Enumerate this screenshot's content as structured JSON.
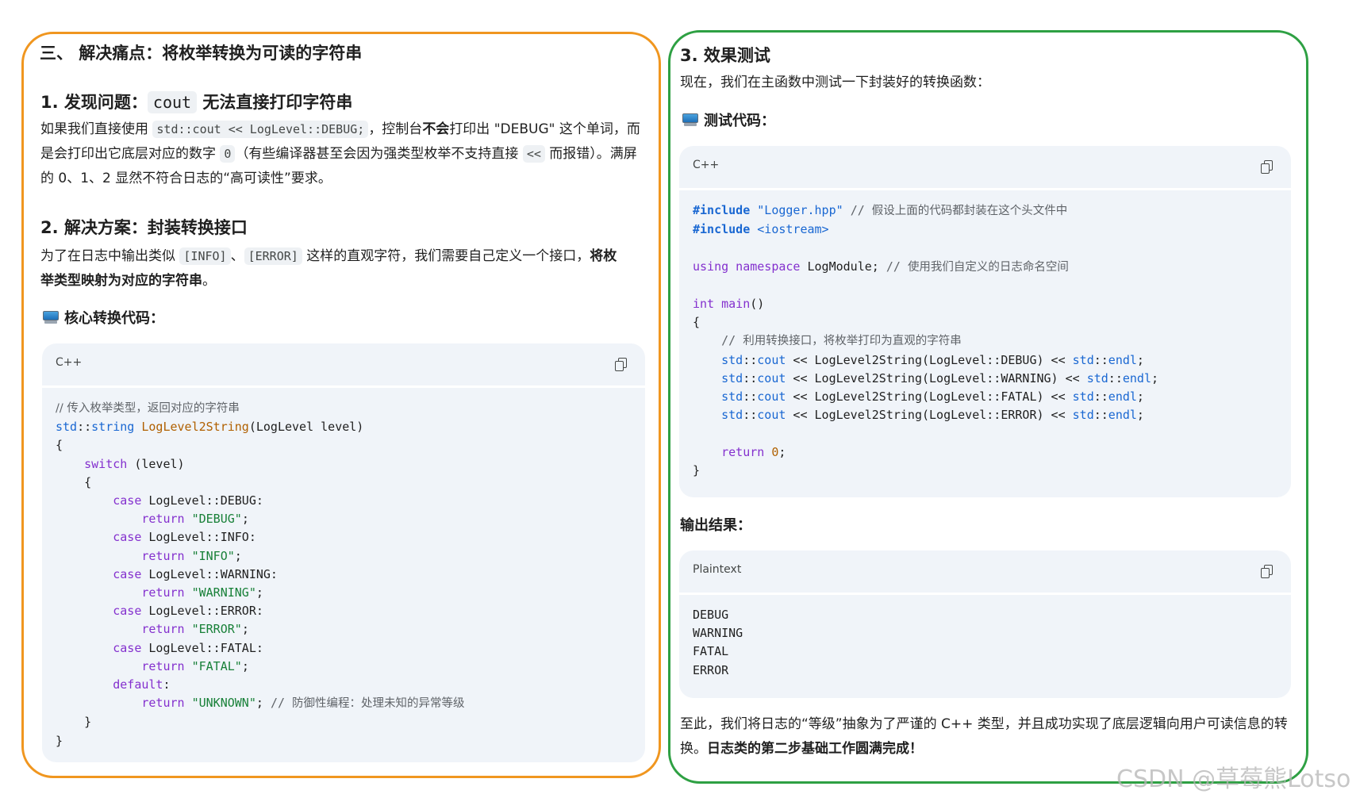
{
  "left": {
    "section_title": "三、 解决痛点：将枚举转换为可读的字符串",
    "step1": {
      "prefix": "1. 发现问题：",
      "code": "cout",
      "suffix": " 无法直接打印字符串"
    },
    "para1": {
      "t1": "如果我们直接使用 ",
      "c1": "std::cout << LogLevel::DEBUG;",
      "t2": "，控制台",
      "b1": "不会",
      "t3": "打印出 \"DEBUG\" 这个单词，而是会打印出它底层对应的数字 ",
      "c2": "0",
      "t4": "（有些编译器甚至会因为强类型枚举不支持直接 ",
      "c3": "<<",
      "t5": " 而报错）。满屏的 0、1、2 显然不符合日志的“高可读性”要求。"
    },
    "step2": "2. 解决方案：封装转换接口",
    "para2": {
      "t1": "为了在日志中输出类似 ",
      "c1": "[INFO]",
      "t2": "、",
      "c2": "[ERROR]",
      "t3": " 这样的直观字符，我们需要自己定义一个接口，",
      "b1": "将枚举类型映射为对应的字符串",
      "t4": "。"
    },
    "code_label": "核心转换代码：",
    "code_lang": "C++"
  },
  "right": {
    "step3": "3. 效果测试",
    "intro": "现在，我们在主函数中测试一下封装好的转换函数：",
    "test_label": "测试代码：",
    "code_lang": "C++",
    "output_label": "输出结果：",
    "output_lang": "Plaintext",
    "output_lines": [
      "DEBUG",
      "WARNING",
      "FATAL",
      "ERROR"
    ],
    "conclusion": {
      "t1": "至此，我们将日志的“等级”抽象为了严谨的 C++ 类型，并且成功实现了底层逻辑向用户可读信息的转换。",
      "b1": "日志类的第二步基础工作圆满完成！"
    }
  },
  "watermark": "CSDN @草莓熊Lotso"
}
